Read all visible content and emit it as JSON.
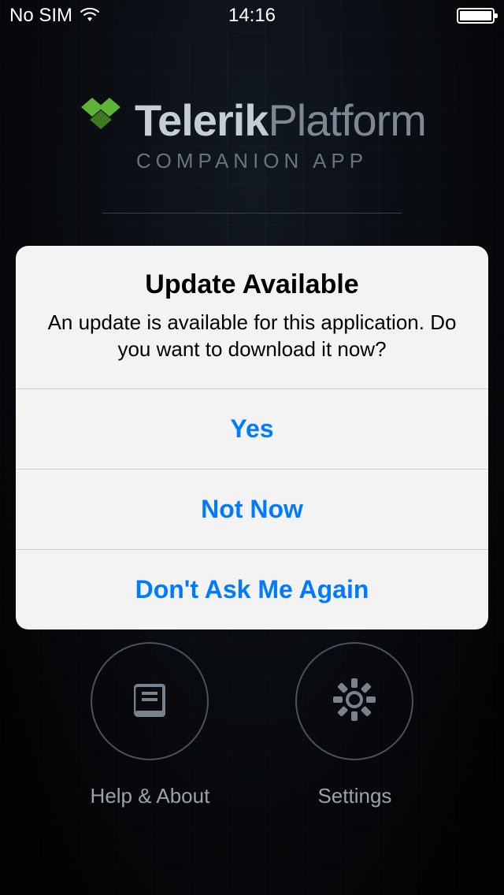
{
  "statusbar": {
    "carrier": "No SIM",
    "time": "14:16"
  },
  "brand": {
    "name_bold": "Telerik",
    "name_light": "Platform",
    "subtitle": "COMPANION APP"
  },
  "bottom": {
    "help_label": "Help & About",
    "settings_label": "Settings"
  },
  "alert": {
    "title": "Update Available",
    "message": "An update is available for this application. Do you want to download it now?",
    "buttons": {
      "yes": "Yes",
      "not_now": "Not Now",
      "dont_ask": "Don't Ask Me Again"
    }
  }
}
